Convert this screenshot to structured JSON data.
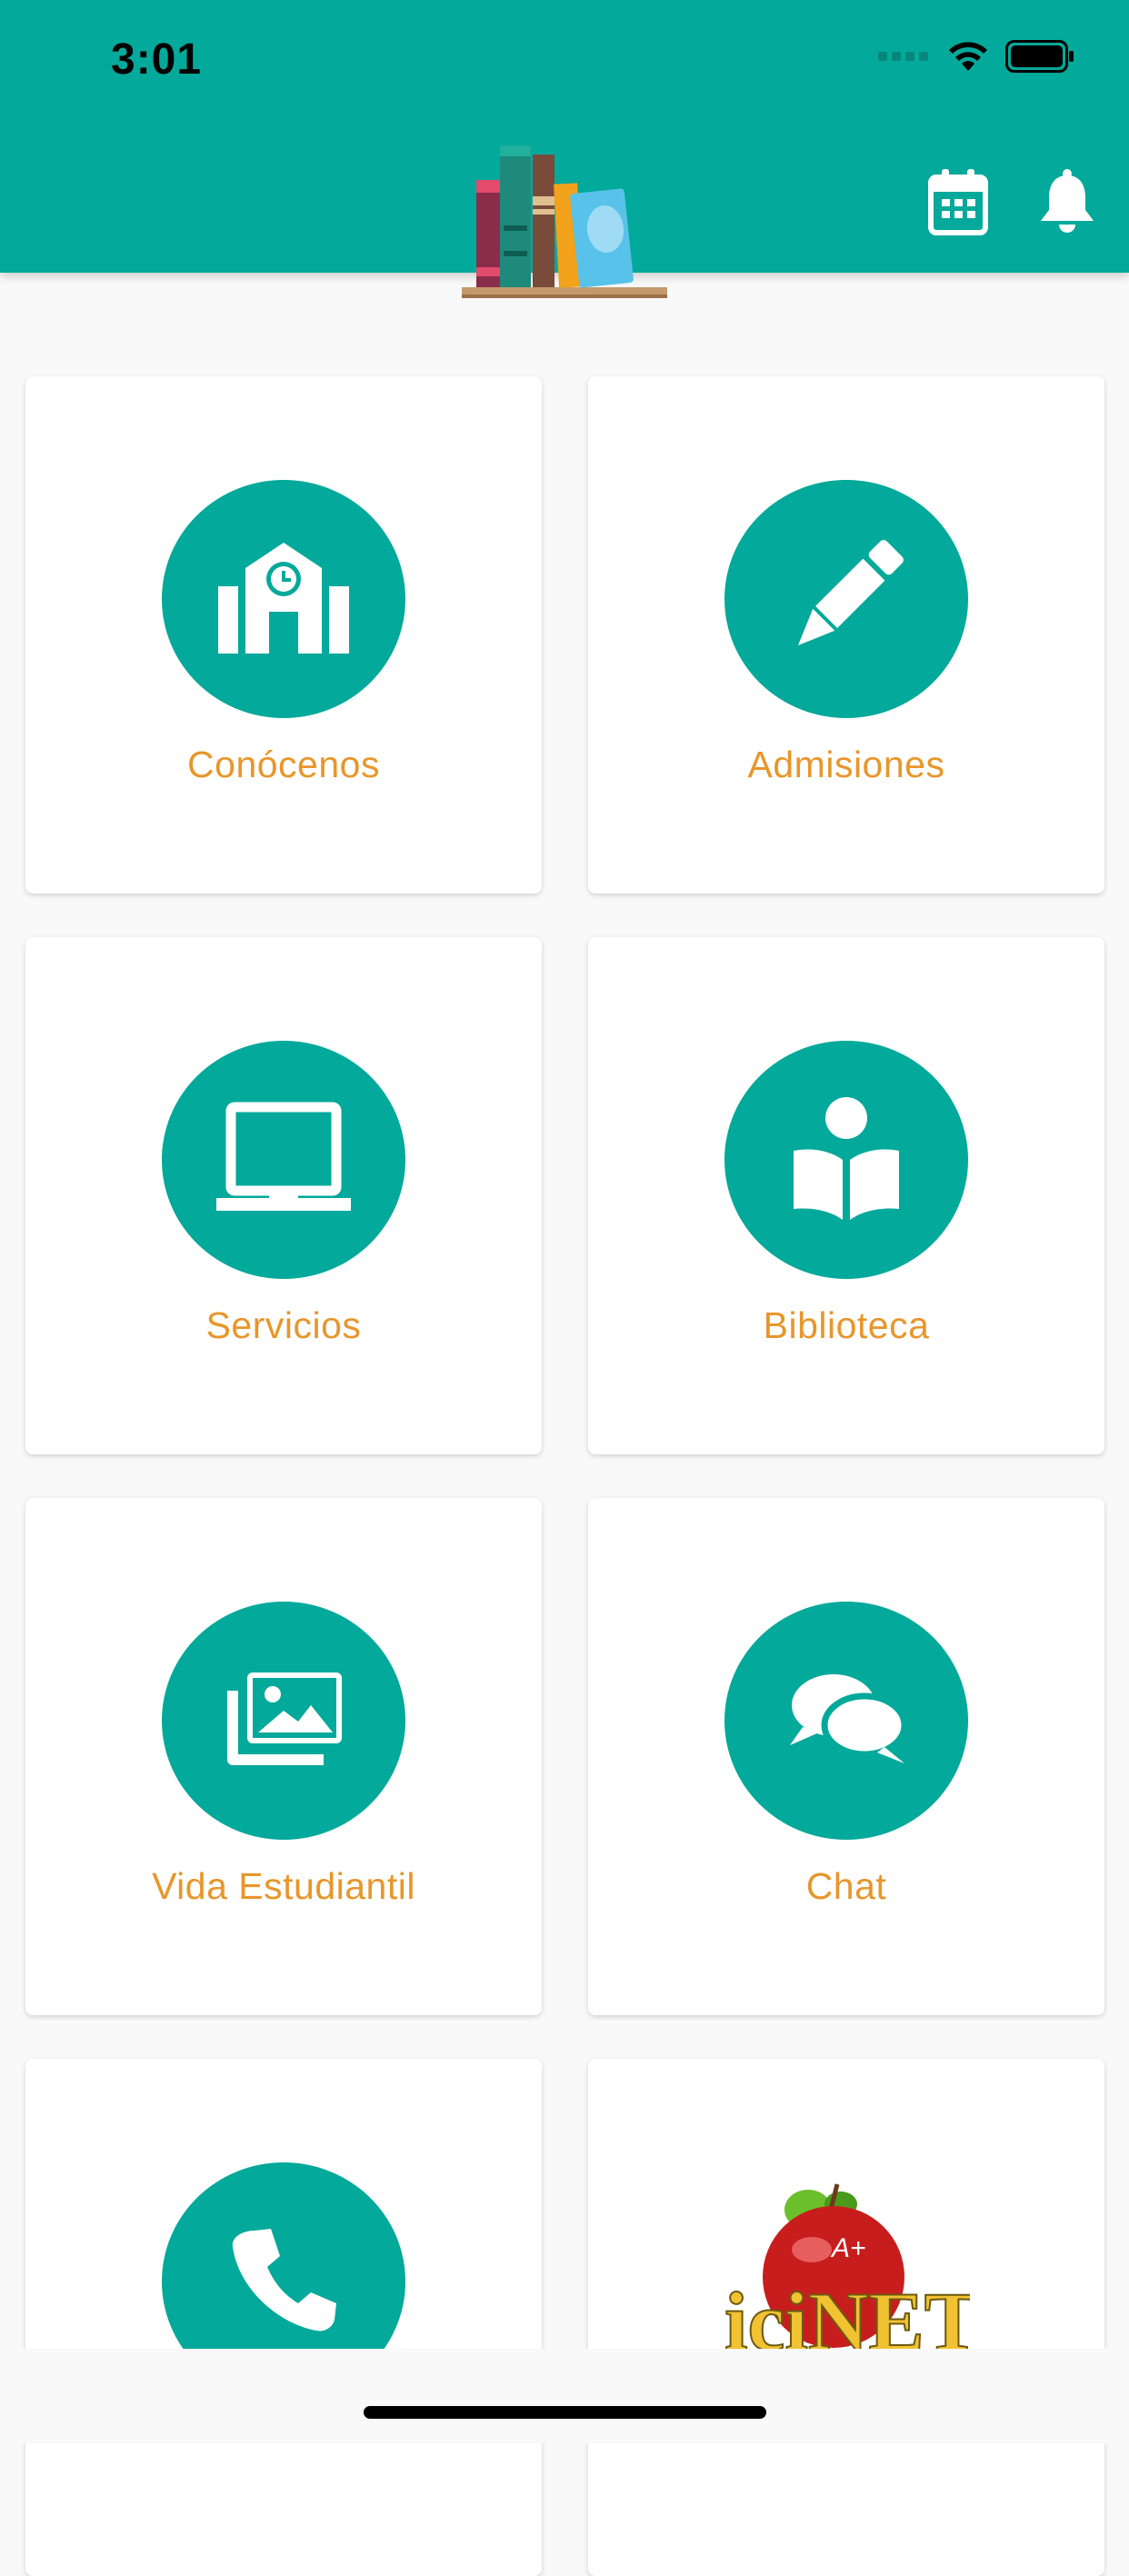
{
  "status_bar": {
    "time": "3:01"
  },
  "header": {
    "logo_icon": "bookshelf-logo",
    "actions": [
      {
        "name": "calendar",
        "icon": "calendar-icon"
      },
      {
        "name": "notifications",
        "icon": "bell-icon"
      }
    ],
    "background_color": "#03a99a"
  },
  "menu": {
    "items": [
      {
        "label": "Conócenos",
        "icon": "school-icon"
      },
      {
        "label": "Admisiones",
        "icon": "pencil-icon"
      },
      {
        "label": "Servicios",
        "icon": "laptop-icon"
      },
      {
        "label": "Biblioteca",
        "icon": "reader-icon"
      },
      {
        "label": "Vida Estudiantil",
        "icon": "photos-icon"
      },
      {
        "label": "Chat",
        "icon": "chat-bubbles-icon"
      },
      {
        "label": "",
        "icon": "phone-icon"
      },
      {
        "label": "",
        "icon": "icinet-logo"
      }
    ],
    "accent_color": "#03a99a",
    "label_color": "#e8962b"
  },
  "logo_text": {
    "badge": "A+",
    "brand": "iciNET"
  }
}
